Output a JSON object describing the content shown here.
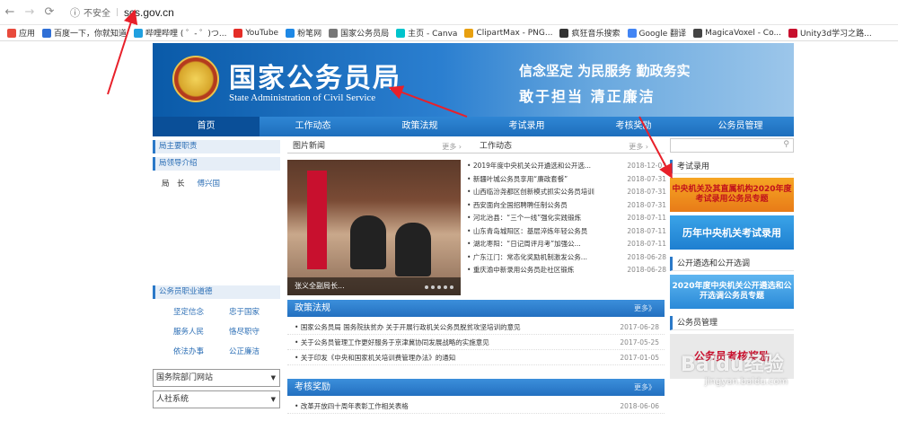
{
  "browser": {
    "back_icon": "arrow-left-icon",
    "forward_icon": "arrow-right-icon",
    "reload_icon": "reload-icon",
    "insecure_label": "不安全",
    "url": "scs.gov.cn"
  },
  "bookmarks": [
    {
      "label": "应用",
      "color": "#e84a3c"
    },
    {
      "label": "百度一下，你就知道",
      "color": "#2f6fd6"
    },
    {
      "label": "哔哩哔哩 ( ゜- ゜)つ...",
      "color": "#20a0e0"
    },
    {
      "label": "YouTube",
      "color": "#e52d27"
    },
    {
      "label": "粉笔网",
      "color": "#1e88e5"
    },
    {
      "label": "国家公务员局",
      "color": "#777777"
    },
    {
      "label": "主页 - Canva",
      "color": "#00c4cc"
    },
    {
      "label": "ClipartMax - PNG...",
      "color": "#e8a010"
    },
    {
      "label": "疯狂音乐搜索",
      "color": "#333333"
    },
    {
      "label": "Google 翻译",
      "color": "#4285f4"
    },
    {
      "label": "MagicaVoxel - Co...",
      "color": "#444444"
    },
    {
      "label": "Unity3d学习之路...",
      "color": "#c8102e"
    }
  ],
  "header": {
    "title_cn": "国家公务员局",
    "title_en": "State Administration of Civil Service",
    "slogan1": "信念坚定  为民服务  勤政务实",
    "slogan2": "敢于担当    清正廉洁"
  },
  "nav": [
    "首页",
    "工作动态",
    "政策法规",
    "考试录用",
    "考核奖励",
    "公务员管理"
  ],
  "left": {
    "duties_label": "局主要职责",
    "leaders_label": "局领导介绍",
    "leader_title": "局　长",
    "leader_name": "傅兴国",
    "ethics_label": "公务员职业道德",
    "ethics": [
      "坚定信念",
      "忠于国家",
      "服务人民",
      "恪尽职守",
      "依法办事",
      "公正廉洁"
    ],
    "select1": "国务院部门网站",
    "select2": "人社系统"
  },
  "mid": {
    "photo_tab": "图片新闻",
    "work_tab": "工作动态",
    "more": "更多",
    "caption": "张义全副局长...",
    "news": [
      {
        "t": "2019年度中央机关公开遴选和公开选...",
        "d": "2018-12-03"
      },
      {
        "t": "新疆叶城公务员享用“廉政套餐”",
        "d": "2018-07-31"
      },
      {
        "t": "山西临汾尧都区创新模式抓实公务员培训",
        "d": "2018-07-31"
      },
      {
        "t": "西安面向全国招聘聘任制公务员",
        "d": "2018-07-31"
      },
      {
        "t": "河北治县：“三个一线”强化实践锻炼",
        "d": "2018-07-11"
      },
      {
        "t": "山东青岛城阳区：基层淬炼年轻公务员",
        "d": "2018-07-11"
      },
      {
        "t": "湖北枣阳：“日记周评月考”加强公...",
        "d": "2018-07-11"
      },
      {
        "t": "广东江门：常态化奖励机制激发公务...",
        "d": "2018-06-28"
      },
      {
        "t": "重庆渝中新录用公务员赴社区锻炼",
        "d": "2018-06-28"
      }
    ],
    "policy_label": "政策法规",
    "policy_more": "更多",
    "policy": [
      {
        "t": "国家公务员局 国务院扶贫办 关于开展行政机关公务员脱贫攻坚培训的意见",
        "d": "2017-06-28"
      },
      {
        "t": "关于公务员管理工作更好服务于京津冀协同发展战略的实施意见",
        "d": "2017-05-25"
      },
      {
        "t": "关于印发《中央和国家机关培训费管理办法》的通知",
        "d": "2017-01-05"
      }
    ],
    "reward_label": "考核奖励",
    "reward_more": "更多",
    "reward": [
      {
        "t": "改革开放四十周年表彰工作相关表格",
        "d": "2018-06-06"
      }
    ]
  },
  "right": {
    "exam_label": "考试录用",
    "promo1": "中央机关及其直属机构2020年度考试录用公务员专题",
    "promo2": "历年中央机关考试录用",
    "selection_label": "公开遴选和公开选调",
    "promo3": "2020年度中央机关公开遴选和公开选调公务员专题",
    "mgmt_label": "公务员管理",
    "promo4": "公务员考核奖励"
  },
  "watermark": {
    "brand": "Baidu经验",
    "url": "jingyan.baidu.com"
  },
  "colors": {
    "banner": "#1d6ebc",
    "nav": "#2f86d4",
    "annotation": "#e8202a"
  }
}
